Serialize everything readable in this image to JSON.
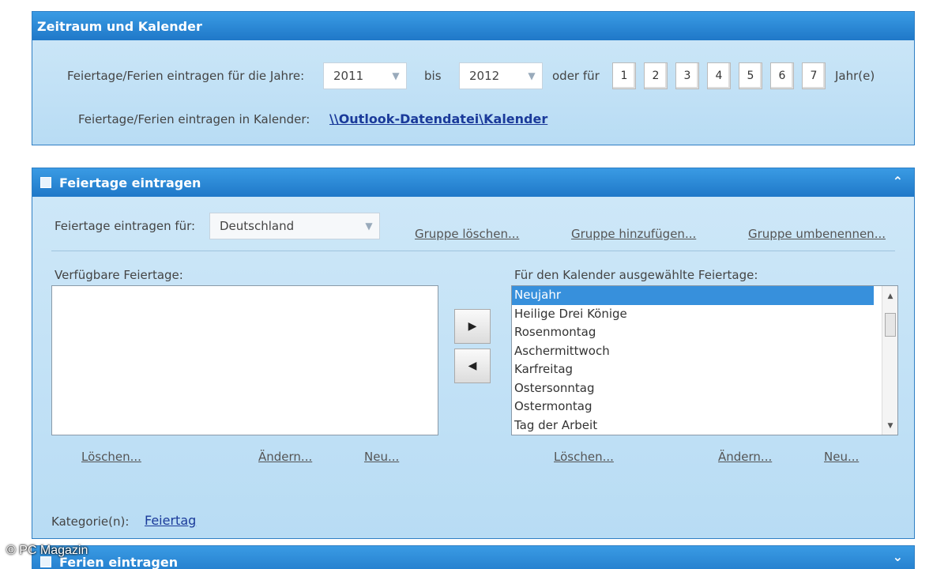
{
  "panel1": {
    "title": "Zeitraum und Kalender",
    "years_label": "Feiertage/Ferien eintragen für die Jahre:",
    "year_from": "2011",
    "to_label": "bis",
    "year_to": "2012",
    "or_for_label": "oder für",
    "year_buttons": [
      "1",
      "2",
      "3",
      "4",
      "5",
      "6",
      "7"
    ],
    "years_suffix": "Jahr(e)",
    "calendar_label": "Feiertage/Ferien eintragen in Kalender:",
    "calendar_link": "\\\\Outlook-Datendatei\\Kalender"
  },
  "panel2": {
    "title": "Feiertage eintragen",
    "enter_for_label": "Feiertage eintragen für:",
    "country": "Deutschland",
    "group_delete": "Gruppe löschen...",
    "group_add": "Gruppe hinzufügen...",
    "group_rename": "Gruppe umbenennen...",
    "available_label": "Verfügbare Feiertage:",
    "selected_label": "Für den Kalender ausgewählte Feiertage:",
    "selected_items": [
      "Neujahr",
      "Heilige Drei Könige",
      "Rosenmontag",
      "Aschermittwoch",
      "Karfreitag",
      "Ostersonntag",
      "Ostermontag",
      "Tag der Arbeit"
    ],
    "left_actions": [
      "Löschen...",
      "Ändern...",
      "Neu..."
    ],
    "right_actions": [
      "Löschen...",
      "Ändern...",
      "Neu..."
    ],
    "category_label": "Kategorie(n):",
    "category_value": "Feiertag"
  },
  "panel3": {
    "title": "Ferien eintragen"
  },
  "watermark": "© PC Magazin",
  "colors": {
    "header": "#1f78c8",
    "panel_bg": "#c4e2f6",
    "selection": "#3790dc",
    "link": "#1a3a9a"
  }
}
